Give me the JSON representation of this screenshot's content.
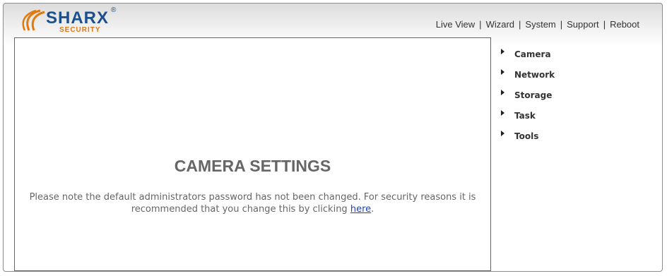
{
  "brand": {
    "name": "SHARX",
    "tagline": "SECURITY",
    "registered": "®"
  },
  "topnav": {
    "items": [
      {
        "label": "Live View"
      },
      {
        "label": "Wizard"
      },
      {
        "label": "System"
      },
      {
        "label": "Support"
      },
      {
        "label": "Reboot"
      }
    ],
    "separator": "|"
  },
  "main": {
    "title": "CAMERA SETTINGS",
    "notice_text": "Please note the default administrators password has not been changed. For security reasons it is recommended that you change this by clicking ",
    "notice_link": "here",
    "notice_end": "."
  },
  "sidebar": {
    "items": [
      {
        "label": "Camera"
      },
      {
        "label": "Network"
      },
      {
        "label": "Storage"
      },
      {
        "label": "Task"
      },
      {
        "label": "Tools"
      }
    ]
  },
  "colors": {
    "brand_blue": "#1d4f8f",
    "brand_orange": "#e07a10",
    "link_blue": "#1a3fd0",
    "title_gray": "#666666"
  }
}
